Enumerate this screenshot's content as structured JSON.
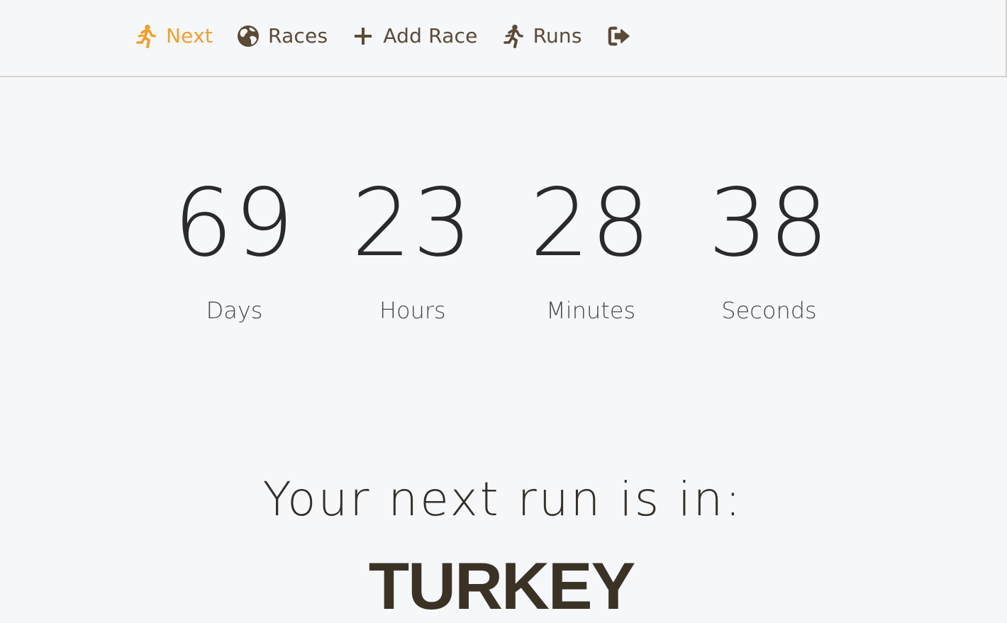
{
  "nav": {
    "items": [
      {
        "label": "Next",
        "icon": "runner-icon",
        "active": true
      },
      {
        "label": "Races",
        "icon": "globe-icon",
        "active": false
      },
      {
        "label": "Add Race",
        "icon": "plus-icon",
        "active": false
      },
      {
        "label": "Runs",
        "icon": "runner-icon",
        "active": false
      },
      {
        "label": "",
        "icon": "sign-out-icon",
        "active": false
      }
    ]
  },
  "countdown": {
    "days": {
      "value": "69",
      "label": "Days"
    },
    "hours": {
      "value": "23",
      "label": "Hours"
    },
    "minutes": {
      "value": "28",
      "label": "Minutes"
    },
    "seconds": {
      "value": "38",
      "label": "Seconds"
    }
  },
  "next_run": {
    "heading": "Your next run is in:",
    "destination": "TURKEY"
  },
  "colors": {
    "background": "#f5f7f9",
    "nav_text": "#5b4a36",
    "nav_active": "#f0a030",
    "digits": "#2a2a2e",
    "destination": "#3b3226"
  }
}
